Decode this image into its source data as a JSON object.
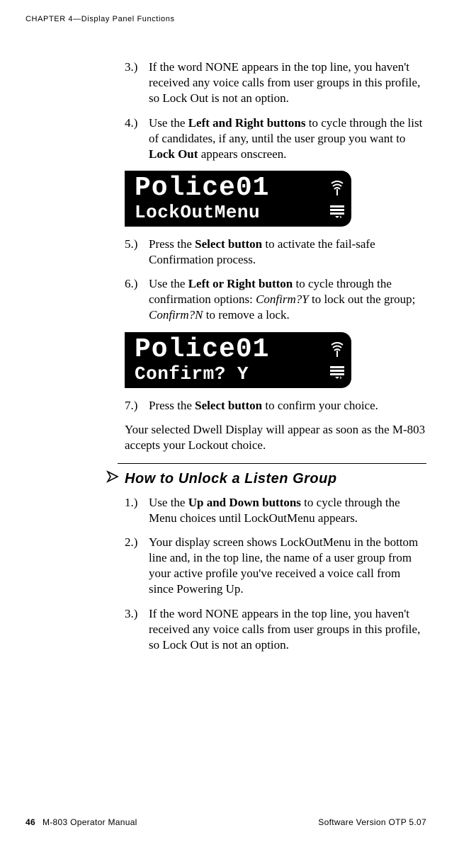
{
  "running_head": "CHAPTER 4—Display Panel Functions",
  "steps_a": {
    "s3": {
      "num": "3.)",
      "text": "If the word NONE appears in the top line, you haven't received any voice calls from user groups in this profile, so Lock Out is not an option."
    },
    "s4": {
      "num": "4.)",
      "pre": "Use the ",
      "b1": "Left and Right buttons",
      "mid": " to cycle through the list of candidates, if any, until the user group you want to ",
      "b2": "Lock Out",
      "post": " appears onscreen."
    },
    "s5": {
      "num": "5.)",
      "pre": "Press the ",
      "b1": "Select button",
      "post": " to activate the fail-safe Confirmation process."
    },
    "s6": {
      "num": "6.)",
      "pre": "Use the ",
      "b1": "Left or Right button",
      "mid1": " to cycle through the confirmation options: ",
      "i1": "Confirm?Y",
      "mid2": " to lock out the group; ",
      "i2": "Confirm?N",
      "post": " to remove a lock."
    },
    "s7": {
      "num": "7.)",
      "pre": "Press the ",
      "b1": "Select button",
      "post": " to confirm your choice."
    }
  },
  "lcd1": {
    "line1": "Police01",
    "line2": "LockOutMenu"
  },
  "lcd2": {
    "line1": "Police01",
    "line2": "Confirm? Y"
  },
  "para1": "Your selected Dwell Display will appear as soon as the M-803 accepts your Lockout choice.",
  "section_title": "How to Unlock a Listen Group",
  "steps_b": {
    "s1": {
      "num": "1.)",
      "pre": "Use the ",
      "b1": "Up and Down buttons",
      "post": " to cycle through the Menu choices until LockOutMenu appears."
    },
    "s2": {
      "num": "2.)",
      "text": "Your display screen shows LockOutMenu in the bottom line and, in the top line, the name of a user group from your active profile you've received a voice call from since Powering Up."
    },
    "s3": {
      "num": "3.)",
      "text": "If the word NONE appears in the top line, you haven't received any voice calls from user groups in this profile, so Lock Out is not an option."
    }
  },
  "footer": {
    "page": "46",
    "left": "M-803 Operator Manual",
    "right": "Software Version OTP 5.07"
  }
}
